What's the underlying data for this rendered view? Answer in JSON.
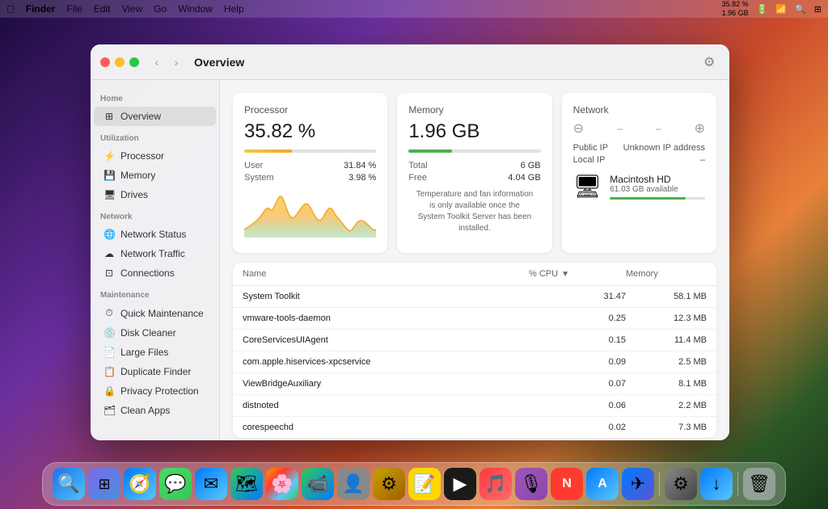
{
  "menubar": {
    "apple": "⌘",
    "app": "Finder",
    "items": [
      "File",
      "Edit",
      "View",
      "Go",
      "Window",
      "Help"
    ],
    "status_cpu": "35.82 %",
    "status_mem": "1.96 GB",
    "time": "—"
  },
  "window": {
    "title": "Overview",
    "settings_icon": "⚙"
  },
  "sidebar": {
    "home_label": "Home",
    "overview_label": "Overview",
    "utilization_label": "Utilization",
    "processor_label": "Processor",
    "memory_label": "Memory",
    "drives_label": "Drives",
    "network_label": "Network",
    "network_status_label": "Network Status",
    "network_traffic_label": "Network Traffic",
    "connections_label": "Connections",
    "maintenance_label": "Maintenance",
    "quick_maintenance_label": "Quick Maintenance",
    "disk_cleaner_label": "Disk Cleaner",
    "large_files_label": "Large Files",
    "duplicate_finder_label": "Duplicate Finder",
    "privacy_protection_label": "Privacy Protection",
    "clean_apps_label": "Clean Apps"
  },
  "processor_card": {
    "title": "Processor",
    "value": "35.82 %",
    "progress": 36,
    "progress_color": "#f5a623",
    "user_label": "User",
    "user_value": "31.84 %",
    "system_label": "System",
    "system_value": "3.98 %"
  },
  "memory_card": {
    "title": "Memory",
    "value": "1.96 GB",
    "progress": 33,
    "progress_color": "#4CAF50",
    "total_label": "Total",
    "total_value": "6 GB",
    "free_label": "Free",
    "free_value": "4.04 GB",
    "temp_notice": "Temperature and fan information is only available once the System Toolkit Server has been installed."
  },
  "network_card": {
    "title": "Network",
    "upload_label": "–",
    "download_label": "–",
    "public_ip_label": "Public IP",
    "public_ip_value": "Unknown IP address",
    "local_ip_label": "Local IP",
    "local_ip_value": "–",
    "hd_name": "Macintosh HD",
    "hd_available": "61.03 GB available",
    "hd_progress": 80
  },
  "process_table": {
    "col_name": "Name",
    "col_cpu": "% CPU",
    "col_memory": "Memory",
    "rows": [
      {
        "name": "System Toolkit",
        "cpu": "31.47",
        "memory": "58.1 MB"
      },
      {
        "name": "vmware-tools-daemon",
        "cpu": "0.25",
        "memory": "12.3 MB"
      },
      {
        "name": "CoreServicesUIAgent",
        "cpu": "0.15",
        "memory": "11.4 MB"
      },
      {
        "name": "com.apple.hiservices-xpcservice",
        "cpu": "0.09",
        "memory": "2.5 MB"
      },
      {
        "name": "ViewBridgeAuxiliary",
        "cpu": "0.07",
        "memory": "8.1 MB"
      },
      {
        "name": "distnoted",
        "cpu": "0.06",
        "memory": "2.2 MB"
      },
      {
        "name": "corespeechd",
        "cpu": "0.02",
        "memory": "7.3 MB"
      }
    ]
  },
  "dock": {
    "items": [
      {
        "id": "finder",
        "icon": "🔍",
        "class": "dock-finder"
      },
      {
        "id": "launchpad",
        "icon": "⊞",
        "class": "dock-launchpad"
      },
      {
        "id": "safari",
        "icon": "🧭",
        "class": "dock-safari"
      },
      {
        "id": "messages",
        "icon": "💬",
        "class": "dock-messages"
      },
      {
        "id": "mail",
        "icon": "✉",
        "class": "dock-mail"
      },
      {
        "id": "maps",
        "icon": "🗺",
        "class": "dock-maps"
      },
      {
        "id": "photos",
        "icon": "🌸",
        "class": "dock-photos"
      },
      {
        "id": "facetime",
        "icon": "📹",
        "class": "dock-facetime"
      },
      {
        "id": "contacts",
        "icon": "👤",
        "class": "dock-contacts"
      },
      {
        "id": "workflow",
        "icon": "⚙",
        "class": "dock-workflow"
      },
      {
        "id": "notes",
        "icon": "📝",
        "class": "dock-notes"
      },
      {
        "id": "appletv",
        "icon": "▶",
        "class": "dock-appletv"
      },
      {
        "id": "music",
        "icon": "♪",
        "class": "dock-music"
      },
      {
        "id": "podcasts",
        "icon": "🎙",
        "class": "dock-podcasts"
      },
      {
        "id": "news",
        "icon": "N",
        "class": "dock-news"
      },
      {
        "id": "appstore",
        "icon": "A",
        "class": "dock-appstore"
      },
      {
        "id": "testflight",
        "icon": "✈",
        "class": "dock-testflight"
      },
      {
        "id": "syspreferences",
        "icon": "⚙",
        "class": "dock-syspreferences"
      },
      {
        "id": "download",
        "icon": "↓",
        "class": "dock-download"
      },
      {
        "id": "trash",
        "icon": "🗑",
        "class": "dock-trash"
      }
    ]
  }
}
